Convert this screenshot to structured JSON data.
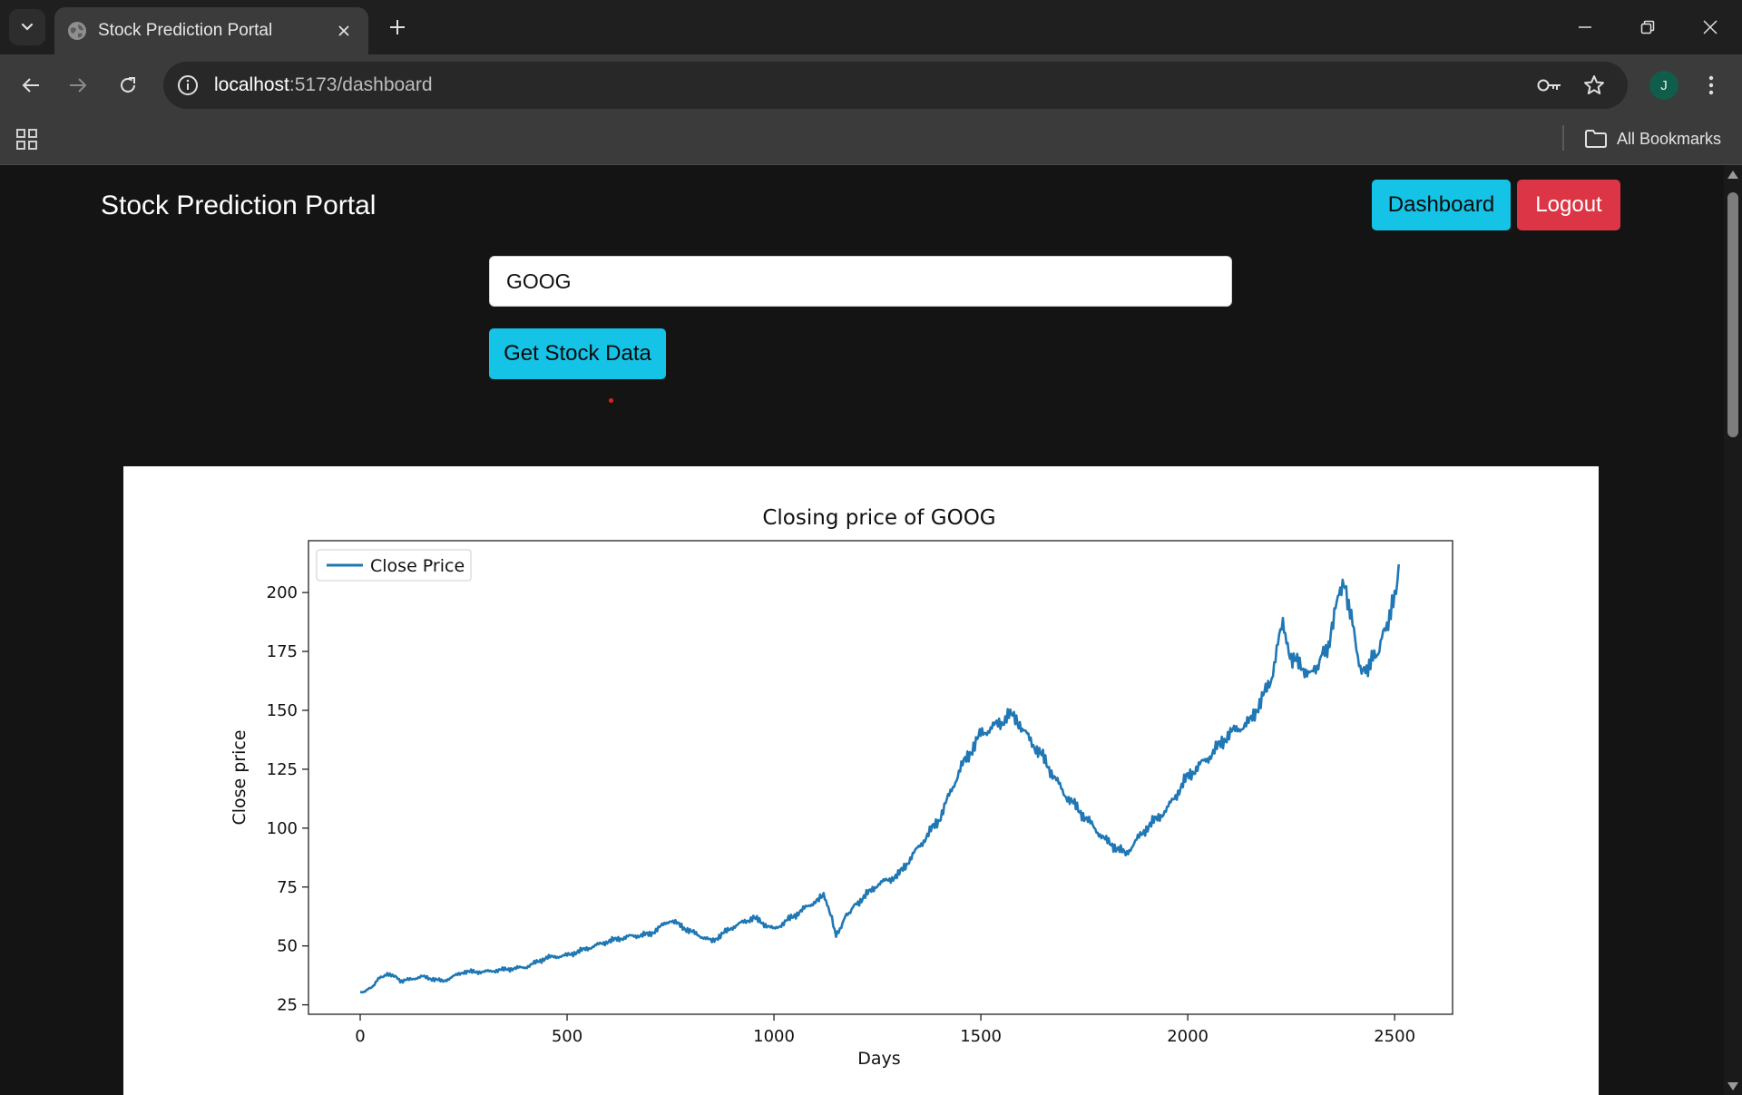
{
  "browser": {
    "tab_title": "Stock Prediction Portal",
    "url_host": "localhost",
    "url_path": ":5173/dashboard",
    "bookmarks_label": "All Bookmarks",
    "avatar_letter": "J"
  },
  "header": {
    "brand": "Stock Prediction Portal",
    "dashboard_label": "Dashboard",
    "logout_label": "Logout"
  },
  "form": {
    "ticker_value": "GOOG",
    "submit_label": "Get Stock Data"
  },
  "colors": {
    "accent_cyan": "#14c3e6",
    "danger_red": "#dc3545",
    "page_bg": "#141414",
    "series_blue": "#1f77b4"
  },
  "chart_data": {
    "type": "line",
    "title": "Closing price of GOOG",
    "xlabel": "Days",
    "ylabel": "Close price",
    "xlim": [
      -125,
      2640
    ],
    "ylim": [
      21,
      222
    ],
    "xticks": [
      0,
      500,
      1000,
      1500,
      2000,
      2500
    ],
    "yticks": [
      25,
      50,
      75,
      100,
      125,
      150,
      175,
      200
    ],
    "legend": "upper left",
    "grid": false,
    "series": [
      {
        "name": "Close Price",
        "x": [
          0,
          25,
          50,
          75,
          100,
          150,
          200,
          250,
          300,
          350,
          400,
          450,
          500,
          550,
          600,
          650,
          700,
          750,
          800,
          850,
          900,
          950,
          1000,
          1050,
          1100,
          1120,
          1140,
          1150,
          1175,
          1200,
          1250,
          1300,
          1350,
          1400,
          1450,
          1500,
          1550,
          1580,
          1600,
          1650,
          1700,
          1750,
          1800,
          1850,
          1900,
          1950,
          2000,
          2050,
          2100,
          2150,
          2200,
          2230,
          2250,
          2300,
          2340,
          2360,
          2380,
          2420,
          2460,
          2500,
          2510
        ],
        "y": [
          30,
          32,
          37,
          38,
          35,
          37,
          35,
          39,
          39,
          40,
          41,
          45,
          46,
          49,
          52,
          54,
          55,
          61,
          56,
          52,
          58,
          62,
          57,
          63,
          69,
          71,
          62,
          54,
          63,
          68,
          76,
          80,
          92,
          104,
          125,
          140,
          145,
          149,
          142,
          130,
          115,
          105,
          95,
          89,
          100,
          108,
          122,
          130,
          140,
          145,
          162,
          188,
          172,
          165,
          178,
          195,
          204,
          165,
          175,
          197,
          212
        ]
      }
    ]
  }
}
